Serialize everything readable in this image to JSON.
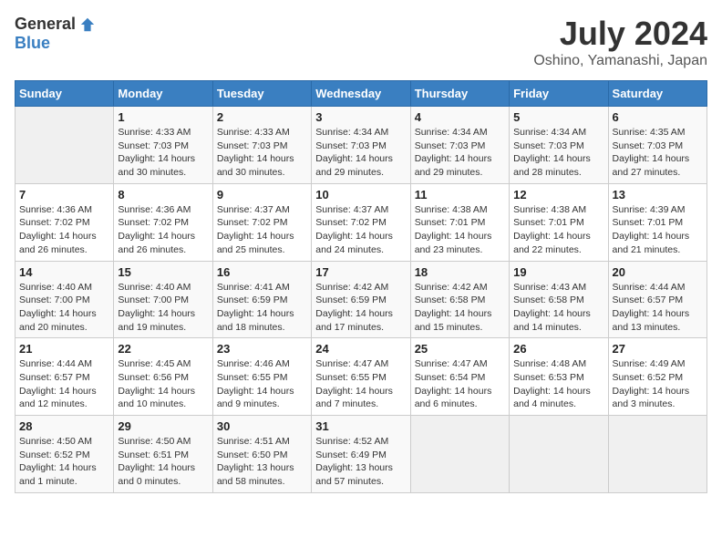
{
  "logo": {
    "general": "General",
    "blue": "Blue"
  },
  "title": "July 2024",
  "subtitle": "Oshino, Yamanashi, Japan",
  "days_of_week": [
    "Sunday",
    "Monday",
    "Tuesday",
    "Wednesday",
    "Thursday",
    "Friday",
    "Saturday"
  ],
  "weeks": [
    [
      {
        "day": "",
        "sunrise": "",
        "sunset": "",
        "daylight": "",
        "empty": true
      },
      {
        "day": "1",
        "sunrise": "Sunrise: 4:33 AM",
        "sunset": "Sunset: 7:03 PM",
        "daylight": "Daylight: 14 hours and 30 minutes."
      },
      {
        "day": "2",
        "sunrise": "Sunrise: 4:33 AM",
        "sunset": "Sunset: 7:03 PM",
        "daylight": "Daylight: 14 hours and 30 minutes."
      },
      {
        "day": "3",
        "sunrise": "Sunrise: 4:34 AM",
        "sunset": "Sunset: 7:03 PM",
        "daylight": "Daylight: 14 hours and 29 minutes."
      },
      {
        "day": "4",
        "sunrise": "Sunrise: 4:34 AM",
        "sunset": "Sunset: 7:03 PM",
        "daylight": "Daylight: 14 hours and 29 minutes."
      },
      {
        "day": "5",
        "sunrise": "Sunrise: 4:34 AM",
        "sunset": "Sunset: 7:03 PM",
        "daylight": "Daylight: 14 hours and 28 minutes."
      },
      {
        "day": "6",
        "sunrise": "Sunrise: 4:35 AM",
        "sunset": "Sunset: 7:03 PM",
        "daylight": "Daylight: 14 hours and 27 minutes."
      }
    ],
    [
      {
        "day": "7",
        "sunrise": "Sunrise: 4:36 AM",
        "sunset": "Sunset: 7:02 PM",
        "daylight": "Daylight: 14 hours and 26 minutes."
      },
      {
        "day": "8",
        "sunrise": "Sunrise: 4:36 AM",
        "sunset": "Sunset: 7:02 PM",
        "daylight": "Daylight: 14 hours and 26 minutes."
      },
      {
        "day": "9",
        "sunrise": "Sunrise: 4:37 AM",
        "sunset": "Sunset: 7:02 PM",
        "daylight": "Daylight: 14 hours and 25 minutes."
      },
      {
        "day": "10",
        "sunrise": "Sunrise: 4:37 AM",
        "sunset": "Sunset: 7:02 PM",
        "daylight": "Daylight: 14 hours and 24 minutes."
      },
      {
        "day": "11",
        "sunrise": "Sunrise: 4:38 AM",
        "sunset": "Sunset: 7:01 PM",
        "daylight": "Daylight: 14 hours and 23 minutes."
      },
      {
        "day": "12",
        "sunrise": "Sunrise: 4:38 AM",
        "sunset": "Sunset: 7:01 PM",
        "daylight": "Daylight: 14 hours and 22 minutes."
      },
      {
        "day": "13",
        "sunrise": "Sunrise: 4:39 AM",
        "sunset": "Sunset: 7:01 PM",
        "daylight": "Daylight: 14 hours and 21 minutes."
      }
    ],
    [
      {
        "day": "14",
        "sunrise": "Sunrise: 4:40 AM",
        "sunset": "Sunset: 7:00 PM",
        "daylight": "Daylight: 14 hours and 20 minutes."
      },
      {
        "day": "15",
        "sunrise": "Sunrise: 4:40 AM",
        "sunset": "Sunset: 7:00 PM",
        "daylight": "Daylight: 14 hours and 19 minutes."
      },
      {
        "day": "16",
        "sunrise": "Sunrise: 4:41 AM",
        "sunset": "Sunset: 6:59 PM",
        "daylight": "Daylight: 14 hours and 18 minutes."
      },
      {
        "day": "17",
        "sunrise": "Sunrise: 4:42 AM",
        "sunset": "Sunset: 6:59 PM",
        "daylight": "Daylight: 14 hours and 17 minutes."
      },
      {
        "day": "18",
        "sunrise": "Sunrise: 4:42 AM",
        "sunset": "Sunset: 6:58 PM",
        "daylight": "Daylight: 14 hours and 15 minutes."
      },
      {
        "day": "19",
        "sunrise": "Sunrise: 4:43 AM",
        "sunset": "Sunset: 6:58 PM",
        "daylight": "Daylight: 14 hours and 14 minutes."
      },
      {
        "day": "20",
        "sunrise": "Sunrise: 4:44 AM",
        "sunset": "Sunset: 6:57 PM",
        "daylight": "Daylight: 14 hours and 13 minutes."
      }
    ],
    [
      {
        "day": "21",
        "sunrise": "Sunrise: 4:44 AM",
        "sunset": "Sunset: 6:57 PM",
        "daylight": "Daylight: 14 hours and 12 minutes."
      },
      {
        "day": "22",
        "sunrise": "Sunrise: 4:45 AM",
        "sunset": "Sunset: 6:56 PM",
        "daylight": "Daylight: 14 hours and 10 minutes."
      },
      {
        "day": "23",
        "sunrise": "Sunrise: 4:46 AM",
        "sunset": "Sunset: 6:55 PM",
        "daylight": "Daylight: 14 hours and 9 minutes."
      },
      {
        "day": "24",
        "sunrise": "Sunrise: 4:47 AM",
        "sunset": "Sunset: 6:55 PM",
        "daylight": "Daylight: 14 hours and 7 minutes."
      },
      {
        "day": "25",
        "sunrise": "Sunrise: 4:47 AM",
        "sunset": "Sunset: 6:54 PM",
        "daylight": "Daylight: 14 hours and 6 minutes."
      },
      {
        "day": "26",
        "sunrise": "Sunrise: 4:48 AM",
        "sunset": "Sunset: 6:53 PM",
        "daylight": "Daylight: 14 hours and 4 minutes."
      },
      {
        "day": "27",
        "sunrise": "Sunrise: 4:49 AM",
        "sunset": "Sunset: 6:52 PM",
        "daylight": "Daylight: 14 hours and 3 minutes."
      }
    ],
    [
      {
        "day": "28",
        "sunrise": "Sunrise: 4:50 AM",
        "sunset": "Sunset: 6:52 PM",
        "daylight": "Daylight: 14 hours and 1 minute."
      },
      {
        "day": "29",
        "sunrise": "Sunrise: 4:50 AM",
        "sunset": "Sunset: 6:51 PM",
        "daylight": "Daylight: 14 hours and 0 minutes."
      },
      {
        "day": "30",
        "sunrise": "Sunrise: 4:51 AM",
        "sunset": "Sunset: 6:50 PM",
        "daylight": "Daylight: 13 hours and 58 minutes."
      },
      {
        "day": "31",
        "sunrise": "Sunrise: 4:52 AM",
        "sunset": "Sunset: 6:49 PM",
        "daylight": "Daylight: 13 hours and 57 minutes."
      },
      {
        "day": "",
        "sunrise": "",
        "sunset": "",
        "daylight": "",
        "empty": true
      },
      {
        "day": "",
        "sunrise": "",
        "sunset": "",
        "daylight": "",
        "empty": true
      },
      {
        "day": "",
        "sunrise": "",
        "sunset": "",
        "daylight": "",
        "empty": true
      }
    ]
  ]
}
